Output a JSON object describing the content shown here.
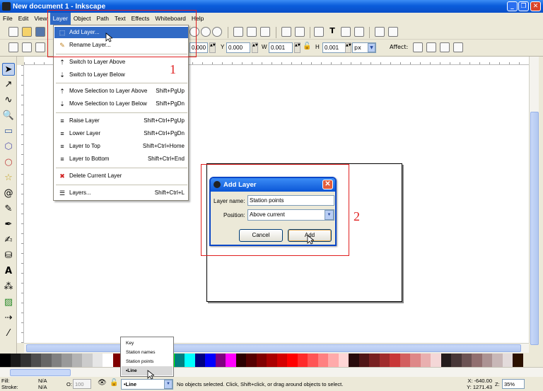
{
  "window": {
    "title": "New document 1 - Inkscape",
    "min": "_",
    "max": "❐",
    "close": "✕"
  },
  "menubar": [
    "File",
    "Edit",
    "View",
    "Layer",
    "Object",
    "Path",
    "Text",
    "Effects",
    "Whiteboard",
    "Help"
  ],
  "toolbar2": {
    "x_label": "X",
    "x_value": "0.000",
    "y_label": "Y",
    "y_value": "0.000",
    "w_label": "W",
    "w_value": "0.001",
    "h_label": "H",
    "h_value": "0.001",
    "unit": "px",
    "affect_label": "Affect:"
  },
  "layer_menu": {
    "items": [
      {
        "label": "Add Layer...",
        "shortcut": ""
      },
      {
        "label": "Rename Layer...",
        "shortcut": ""
      },
      {
        "label": "Switch to Layer Above",
        "shortcut": ""
      },
      {
        "label": "Switch to Layer Below",
        "shortcut": ""
      },
      {
        "label": "Move Selection to Layer Above",
        "shortcut": "Shift+PgUp"
      },
      {
        "label": "Move Selection to Layer Below",
        "shortcut": "Shift+PgDn"
      },
      {
        "label": "Raise Layer",
        "shortcut": "Shift+Ctrl+PgUp"
      },
      {
        "label": "Lower Layer",
        "shortcut": "Shift+Ctrl+PgDn"
      },
      {
        "label": "Layer to Top",
        "shortcut": "Shift+Ctrl+Home"
      },
      {
        "label": "Layer to Bottom",
        "shortcut": "Shift+Ctrl+End"
      },
      {
        "label": "Delete Current Layer",
        "shortcut": ""
      },
      {
        "label": "Layers...",
        "shortcut": "Shift+Ctrl+L"
      }
    ]
  },
  "annotations": {
    "one": "1",
    "two": "2"
  },
  "dialog": {
    "title": "Add Layer",
    "layer_name_label": "Layer name:",
    "layer_name_value": "Station points",
    "position_label": "Position:",
    "position_value": "Above current",
    "cancel": "Cancel",
    "add": "Add"
  },
  "layer_popup": [
    "Key",
    "Station names",
    "Station points",
    "•Line"
  ],
  "statusbar": {
    "fill_label": "Fill:",
    "stroke_label": "Stroke:",
    "fill_value": "N/A",
    "stroke_value": "N/A",
    "opacity_label": "O:",
    "opacity_value": "100",
    "current_layer": "•Line",
    "message": "No objects selected. Click, Shift+click, or drag around objects to select.",
    "x_coord": "X: -640.00",
    "y_coord": "Y: 1271.43",
    "zoom_label": "Z:",
    "zoom_value": "35%"
  },
  "colors": {
    "xp_blue": "#0a5ddb",
    "highlight": "#316ac5",
    "annotation_red": "#e02020",
    "palette": [
      "#000000",
      "#1a1a1a",
      "#333333",
      "#4d4d4d",
      "#666666",
      "#808080",
      "#999999",
      "#b3b3b3",
      "#cccccc",
      "#e6e6e6",
      "#ffffff",
      "#800000",
      "#ff0000",
      "#808000",
      "#ffff00",
      "#008000",
      "#00ff00",
      "#008080",
      "#00ffff",
      "#000080",
      "#0000ff",
      "#800080",
      "#ff00ff",
      "#2b0000",
      "#550000",
      "#800000",
      "#aa0000",
      "#d40000",
      "#ff0000",
      "#ff2a2a",
      "#ff5555",
      "#ff8080",
      "#ffaaaa",
      "#ffd5d5",
      "#280b0b",
      "#501616",
      "#782121",
      "#a02c2c",
      "#c83737",
      "#d35f5f",
      "#de8787",
      "#e9afaf",
      "#f4d7d7",
      "#241c1c",
      "#483737",
      "#6c5353",
      "#916f6f",
      "#ac9393",
      "#c8b7b7",
      "#e3dbdb",
      "#2b1100"
    ]
  }
}
